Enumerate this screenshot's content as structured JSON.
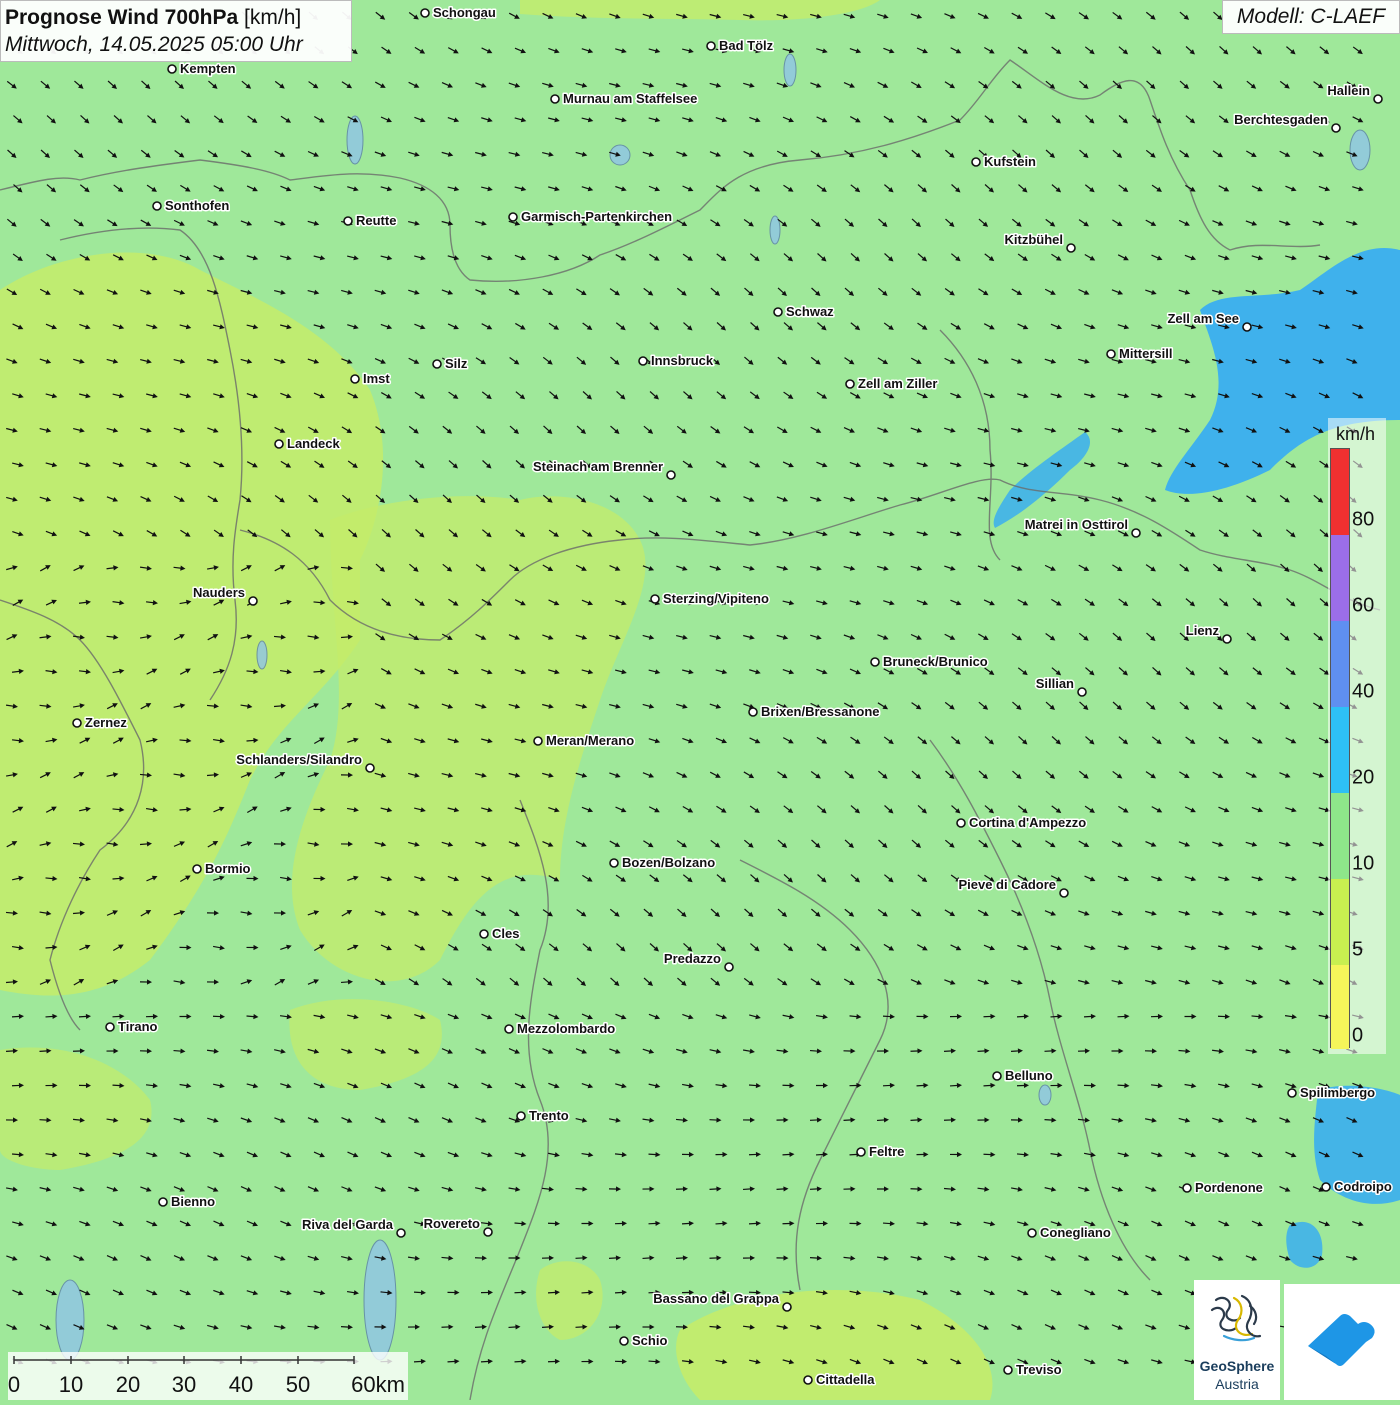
{
  "title": {
    "main": "Prognose Wind 700hPa",
    "unit": "[km/h]",
    "datetime": "Mittwoch, 14.05.2025 05:00 Uhr"
  },
  "model": "Modell: C-LAEF",
  "legend": {
    "unit": "km/h",
    "ticks": [
      "80",
      "60",
      "40",
      "20",
      "10",
      "5",
      "0"
    ],
    "colors": [
      "#f03030",
      "#9b6ee8",
      "#5f8ff0",
      "#2ec0f5",
      "#8ee68a",
      "#c8ef50",
      "#f5f55a"
    ]
  },
  "colors": {
    "background_green": "#9fe89a",
    "calm_yellow_green": "#c4ec6a",
    "strong_blue": "#3aaef0",
    "arrow": "#111111",
    "border_line": "#6a6a6a"
  },
  "scale": {
    "labels": [
      "0",
      "10",
      "20",
      "30",
      "40",
      "50",
      "60km"
    ]
  },
  "logo": {
    "line1": "GeoSphere",
    "line2": "Austria"
  },
  "cities": [
    {
      "name": "Schongau"
    },
    {
      "name": "Bad Tölz"
    },
    {
      "name": "Kempten"
    },
    {
      "name": "Murnau am Staffelsee"
    },
    {
      "name": "Hallein"
    },
    {
      "name": "Berchtesgaden"
    },
    {
      "name": "Kufstein"
    },
    {
      "name": "Sonthofen"
    },
    {
      "name": "Reutte"
    },
    {
      "name": "Garmisch-Partenkirchen"
    },
    {
      "name": "Kitzbühel"
    },
    {
      "name": "Schwaz"
    },
    {
      "name": "Zell am See"
    },
    {
      "name": "Mittersill"
    },
    {
      "name": "Innsbruck"
    },
    {
      "name": "Silz"
    },
    {
      "name": "Imst"
    },
    {
      "name": "Zell am Ziller"
    },
    {
      "name": "Landeck"
    },
    {
      "name": "Steinach am Brenner"
    },
    {
      "name": "Matrei in Osttirol"
    },
    {
      "name": "Nauders"
    },
    {
      "name": "Sterzing/Vipiteno"
    },
    {
      "name": "Lienz"
    },
    {
      "name": "Bruneck/Brunico"
    },
    {
      "name": "Sillian"
    },
    {
      "name": "Brixen/Bressanone"
    },
    {
      "name": "Zernez"
    },
    {
      "name": "Meran/Merano"
    },
    {
      "name": "Schlanders/Silandro"
    },
    {
      "name": "Cortina d'Ampezzo"
    },
    {
      "name": "Bozen/Bolzano"
    },
    {
      "name": "Bormio"
    },
    {
      "name": "Pieve di Cadore"
    },
    {
      "name": "Cles"
    },
    {
      "name": "Predazzo"
    },
    {
      "name": "Tirano"
    },
    {
      "name": "Mezzolombardo"
    },
    {
      "name": "Belluno"
    },
    {
      "name": "Spilimbergo"
    },
    {
      "name": "Trento"
    },
    {
      "name": "Feltre"
    },
    {
      "name": "Pordenone"
    },
    {
      "name": "Codroipo"
    },
    {
      "name": "Bienno"
    },
    {
      "name": "Riva del Garda"
    },
    {
      "name": "Rovereto"
    },
    {
      "name": "Conegliano"
    },
    {
      "name": "Bassano del Grappa"
    },
    {
      "name": "Schio"
    },
    {
      "name": "Treviso"
    },
    {
      "name": "Cittadella"
    }
  ]
}
